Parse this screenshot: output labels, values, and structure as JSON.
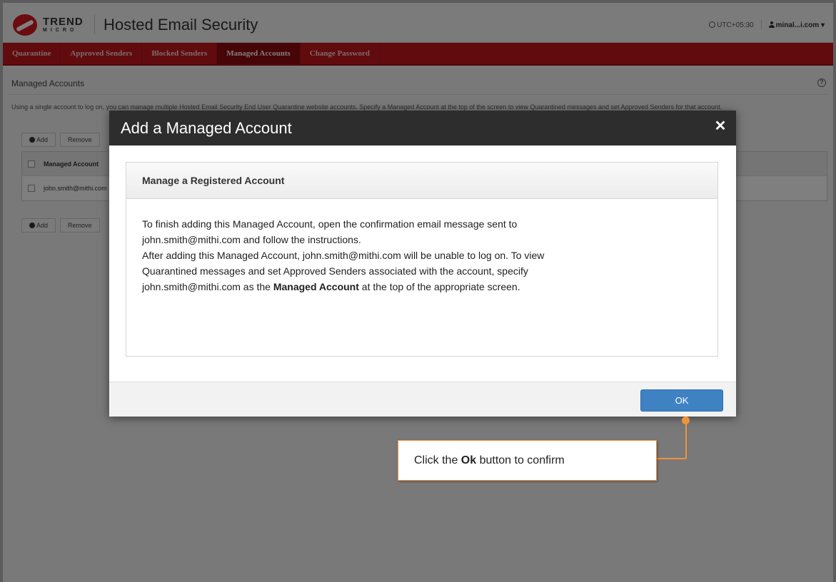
{
  "header": {
    "brand_line1": "TREND",
    "brand_line2": "MICRO",
    "app_title": "Hosted Email Security",
    "timezone": "UTC+05:30",
    "user": "minal...i.com ▾"
  },
  "nav": {
    "items": [
      {
        "label": "Quarantine"
      },
      {
        "label": "Approved Senders"
      },
      {
        "label": "Blocked Senders"
      },
      {
        "label": "Managed Accounts"
      },
      {
        "label": "Change Password"
      }
    ]
  },
  "page": {
    "title": "Managed Accounts",
    "help": "?",
    "description": "Using a single account to log on, you can manage multiple Hosted Email Security End User Quarantine website accounts. Specify a Managed Account at the top of the screen to view Quarantined messages and set Approved Senders for that account.",
    "add_label": "Add",
    "remove_label": "Remove",
    "table_header": "Managed Account",
    "row1": "john.smith@mithi.com"
  },
  "modal": {
    "title": "Add a Managed Account",
    "close": "✕",
    "panel_title": "Manage a Registered Account",
    "line1": "To finish adding this Managed Account, open the confirmation email message sent to",
    "line2": "john.smith@mithi.com and follow the instructions.",
    "line3": "After adding this Managed Account, john.smith@mithi.com will be unable to log on. To view",
    "line4": "Quarantined messages and set Approved Senders associated with the account, specify",
    "line5_pre": "john.smith@mithi.com as the ",
    "line5_bold": "Managed Account",
    "line5_post": " at the top of the appropriate screen.",
    "ok_label": "OK"
  },
  "callout": {
    "pre": "Click the ",
    "bold": "Ok",
    "post": " button to confirm",
    "color": "#f0923a"
  }
}
